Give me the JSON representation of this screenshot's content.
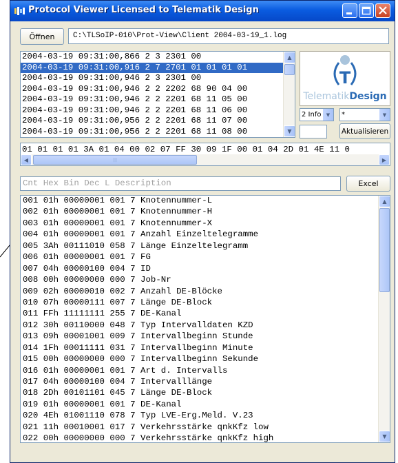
{
  "window": {
    "title": "Protocol Viewer Licensed to Telematik Design"
  },
  "toolbar": {
    "open_label": "Öffnen",
    "file_path": "C:\\TLSoIP-010\\Prot-View\\Client 2004-03-19_1.log"
  },
  "log_entries": [
    "2004-03-19 09:31:00,866 2 3 2301 00",
    "2004-03-19 09:31:00,916 2 7 2701 01 01 01 01",
    "2004-03-19 09:31:00,946 2 3 2301 00",
    "2004-03-19 09:31:00,946 2 2 2202 68 90 04 00",
    "2004-03-19 09:31:00,946 2 2 2201 68 11 05 00",
    "2004-03-19 09:31:00,946 2 2 2201 68 11 06 00",
    "2004-03-19 09:31:00,956 2 2 2201 68 11 07 00",
    "2004-03-19 09:31:00,956 2 2 2201 68 11 08 00"
  ],
  "selected_log_index": 1,
  "logo": {
    "letter": "T",
    "text_light": "Telematik",
    "text_bold": "Design"
  },
  "controls": {
    "info_select": "2 Info",
    "filter_select": "*",
    "update_label": "Aktualisieren"
  },
  "hex_line": "01 01 01 01 3A 01 04 00 02 07 FF 30 09 1F 00 01 04 2D 01 4E 11 0",
  "detail_header": "Cnt Hex Bin      Dec L Description",
  "excel_label": "Excel",
  "detail_rows": [
    "001 01h 00000001 001 7 Knotennummer-L",
    "002 01h 00000001 001 7 Knotennummer-H",
    "003 01h 00000001 001 7 Knotennummer-X",
    "004 01h 00000001 001 7 Anzahl Einzeltelegramme",
    "005 3Ah 00111010 058 7 Länge Einzeltelegramm",
    "006 01h 00000001 001 7 FG",
    "007 04h 00000100 004 7 ID",
    "008 00h 00000000 000 7 Job-Nr",
    "009 02h 00000010 002 7 Anzahl DE-Blöcke",
    "010 07h 00000111 007 7 Länge DE-Block",
    "011 FFh 11111111 255 7 DE-Kanal",
    "012 30h 00110000 048 7 Typ Intervalldaten KZD",
    "013 09h 00001001 009 7 Intervallbeginn Stunde",
    "014 1Fh 00011111 031 7 Intervallbeginn Minute",
    "015 00h 00000000 000 7 Intervallbeginn Sekunde",
    "016 01h 00000001 001 7 Art d. Intervalls",
    "017 04h 00000100 004 7 Intervalllänge",
    "018 2Dh 00101101 045 7 Länge DE-Block",
    "019 01h 00000001 001 7 DE-Kanal",
    "020 4Eh 01001110 078 7 Typ LVE-Erg.Meld. V.23",
    "021 11h 00010001 017 7 Verkehrsstärke qnkKfz low",
    "022 00h 00000000 000 7 Verkehrsstärke qnkKfz high"
  ]
}
